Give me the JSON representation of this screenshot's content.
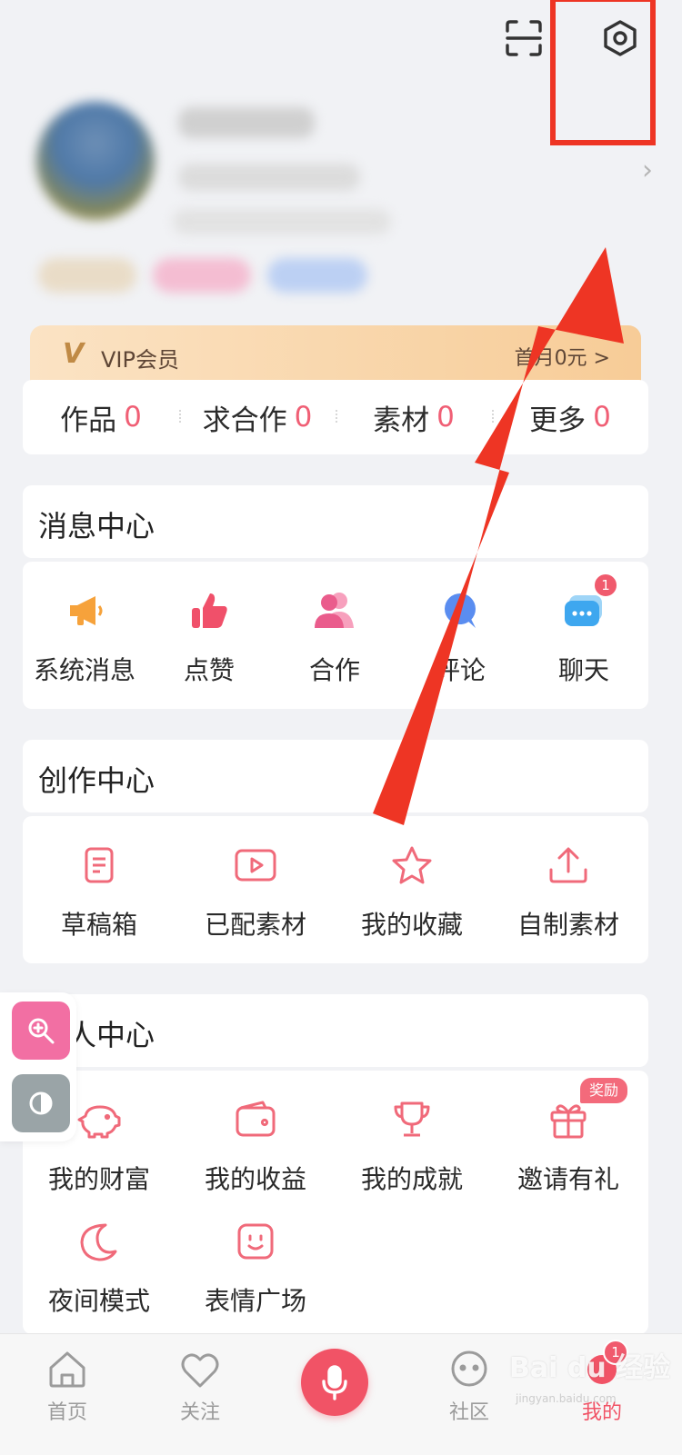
{
  "vip": {
    "label": "VIP会员",
    "promo": "首月0元 >"
  },
  "stats": [
    {
      "label": "作品",
      "count": "0"
    },
    {
      "label": "求合作",
      "count": "0"
    },
    {
      "label": "素材",
      "count": "0"
    },
    {
      "label": "更多",
      "count": "0"
    }
  ],
  "messages": {
    "title": "消息中心",
    "items": [
      {
        "label": "系统消息",
        "icon": "megaphone-icon"
      },
      {
        "label": "点赞",
        "icon": "thumbs-up-icon"
      },
      {
        "label": "合作",
        "icon": "users-icon"
      },
      {
        "label": "评论",
        "icon": "comment-icon"
      },
      {
        "label": "聊天",
        "icon": "chat-icon",
        "badge": "1"
      }
    ]
  },
  "creation": {
    "title": "创作中心",
    "items": [
      {
        "label": "草稿箱",
        "icon": "document-icon"
      },
      {
        "label": "已配素材",
        "icon": "video-icon"
      },
      {
        "label": "我的收藏",
        "icon": "star-icon"
      },
      {
        "label": "自制素材",
        "icon": "upload-icon"
      }
    ]
  },
  "personal": {
    "title": "个人中心",
    "items": [
      {
        "label": "我的财富",
        "icon": "piggy-bank-icon"
      },
      {
        "label": "我的收益",
        "icon": "wallet-icon"
      },
      {
        "label": "我的成就",
        "icon": "trophy-icon"
      },
      {
        "label": "邀请有礼",
        "icon": "gift-icon",
        "badge": "奖励"
      },
      {
        "label": "夜间模式",
        "icon": "moon-icon"
      },
      {
        "label": "表情广场",
        "icon": "emoji-icon"
      }
    ]
  },
  "tabs": [
    {
      "label": "首页",
      "icon": "home-icon"
    },
    {
      "label": "关注",
      "icon": "heart-icon"
    },
    {
      "label": "",
      "icon": "microphone-icon"
    },
    {
      "label": "社区",
      "icon": "community-icon"
    },
    {
      "label": "我的",
      "icon": "profile-icon",
      "badge": "1",
      "active": true
    }
  ],
  "watermark": {
    "main": "Bai du 经验",
    "sub": "jingyan.baidu.com"
  },
  "colors": {
    "accent": "#f05a6d",
    "annotation": "#ee3524",
    "vip_gold": "#c08a45"
  }
}
